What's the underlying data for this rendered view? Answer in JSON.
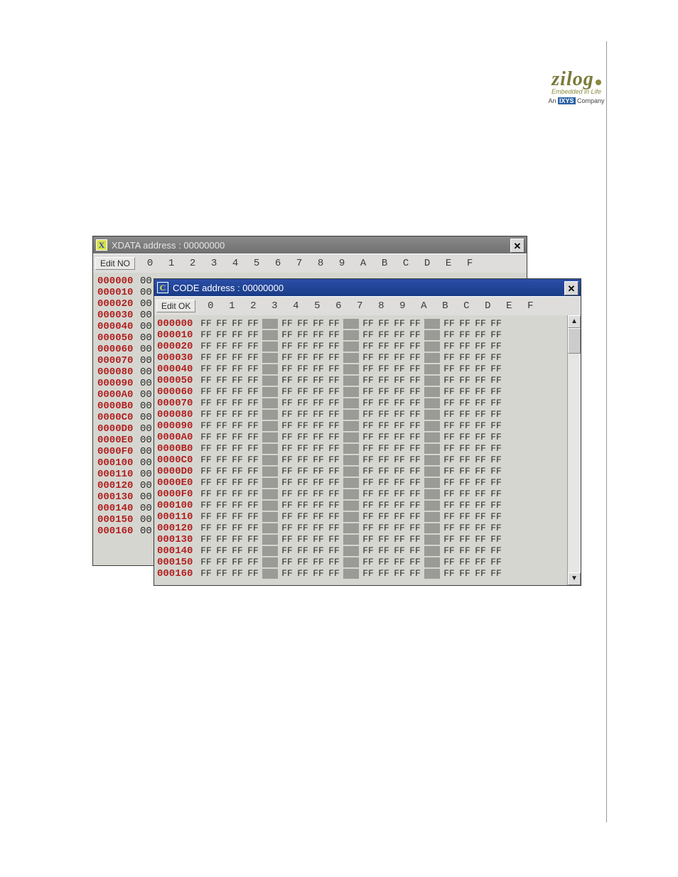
{
  "brand": {
    "name": "zilog",
    "tagline": "Embedded in Life",
    "subline_prefix": "An ",
    "subline_badge": "IXYS",
    "subline_suffix": " Company"
  },
  "back_window": {
    "title": "XDATA address : 00000000",
    "icon_letter": "X",
    "edit_button": "Edit NO",
    "columns": [
      "0",
      "1",
      "2",
      "3",
      "4",
      "5",
      "6",
      "7",
      "8",
      "9",
      "A",
      "B",
      "C",
      "D",
      "E",
      "F"
    ],
    "rows": [
      {
        "addr": "000000",
        "b0": "00"
      },
      {
        "addr": "000010",
        "b0": "00"
      },
      {
        "addr": "000020",
        "b0": "00"
      },
      {
        "addr": "000030",
        "b0": "00"
      },
      {
        "addr": "000040",
        "b0": "00"
      },
      {
        "addr": "000050",
        "b0": "00"
      },
      {
        "addr": "000060",
        "b0": "00"
      },
      {
        "addr": "000070",
        "b0": "00"
      },
      {
        "addr": "000080",
        "b0": "00"
      },
      {
        "addr": "000090",
        "b0": "00"
      },
      {
        "addr": "0000A0",
        "b0": "00"
      },
      {
        "addr": "0000B0",
        "b0": "00"
      },
      {
        "addr": "0000C0",
        "b0": "00"
      },
      {
        "addr": "0000D0",
        "b0": "00"
      },
      {
        "addr": "0000E0",
        "b0": "00"
      },
      {
        "addr": "0000F0",
        "b0": "00"
      },
      {
        "addr": "000100",
        "b0": "00"
      },
      {
        "addr": "000110",
        "b0": "00"
      },
      {
        "addr": "000120",
        "b0": "00"
      },
      {
        "addr": "000130",
        "b0": "00"
      },
      {
        "addr": "000140",
        "b0": "00"
      },
      {
        "addr": "000150",
        "b0": "00"
      },
      {
        "addr": "000160",
        "b0": "00"
      }
    ]
  },
  "front_window": {
    "title": "CODE address : 00000000",
    "icon_letter": "C",
    "edit_button": "Edit OK",
    "columns": [
      "0",
      "1",
      "2",
      "3",
      "4",
      "5",
      "6",
      "7",
      "8",
      "9",
      "A",
      "B",
      "C",
      "D",
      "E",
      "F"
    ],
    "addresses": [
      "000000",
      "000010",
      "000020",
      "000030",
      "000040",
      "000050",
      "000060",
      "000070",
      "000080",
      "000090",
      "0000A0",
      "0000B0",
      "0000C0",
      "0000D0",
      "0000E0",
      "0000F0",
      "000100",
      "000110",
      "000120",
      "000130",
      "000140",
      "000150",
      "000160"
    ],
    "byte_value": "FF"
  }
}
